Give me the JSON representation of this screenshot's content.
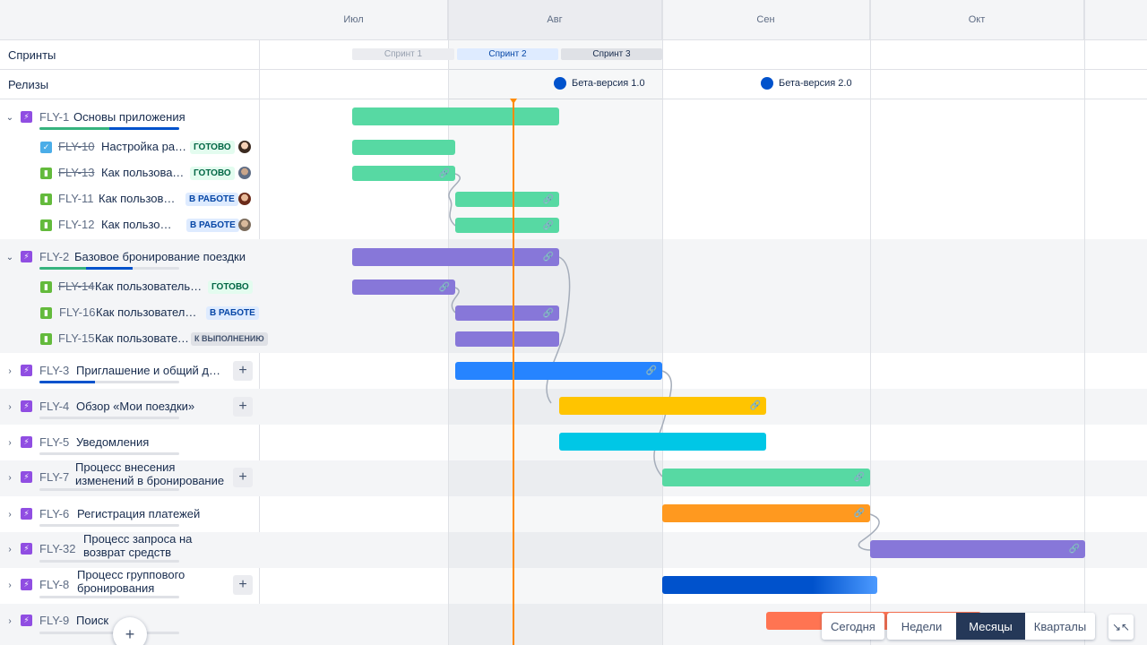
{
  "timeline": {
    "months": [
      "Июл",
      "Авг",
      "Сен",
      "Окт"
    ],
    "sprints_label": "Спринты",
    "releases_label": "Релизы",
    "sprints": [
      "Спринт 1",
      "Спринт 2",
      "Спринт 3"
    ],
    "releases": [
      "Бета-версия 1.0",
      "Бета-версия 2.0"
    ]
  },
  "issues": [
    {
      "key": "FLY-1",
      "title": "Основы приложения",
      "type": "epic",
      "expanded": true
    },
    {
      "key": "FLY-10",
      "title": "Настройка раз…",
      "type": "task",
      "done": true,
      "status": "ГОТОВО"
    },
    {
      "key": "FLY-13",
      "title": "Как пользовате…",
      "type": "story",
      "done": true,
      "status": "ГОТОВО"
    },
    {
      "key": "FLY-11",
      "title": "Как пользов…",
      "type": "story",
      "status": "В РАБОТЕ"
    },
    {
      "key": "FLY-12",
      "title": "Как пользо…",
      "type": "story",
      "status": "В РАБОТЕ"
    },
    {
      "key": "FLY-2",
      "title": "Базовое бронирование поездки",
      "type": "epic",
      "expanded": true
    },
    {
      "key": "FLY-14",
      "title": "Как пользователь,…",
      "type": "story",
      "done": true,
      "status": "ГОТОВО"
    },
    {
      "key": "FLY-16",
      "title": "Как пользовател…",
      "type": "story",
      "status": "В РАБОТЕ"
    },
    {
      "key": "FLY-15",
      "title": "Как пользователь…",
      "type": "story",
      "status": "К ВЫПОЛНЕНИЮ"
    },
    {
      "key": "FLY-3",
      "title": "Приглашение и общий доступ",
      "type": "epic"
    },
    {
      "key": "FLY-4",
      "title": "Обзор «Мои поездки»",
      "type": "epic"
    },
    {
      "key": "FLY-5",
      "title": "Уведомления",
      "type": "epic"
    },
    {
      "key": "FLY-7",
      "title": "Процесс внесения изменений в бронирование",
      "type": "epic"
    },
    {
      "key": "FLY-6",
      "title": "Регистрация платежей",
      "type": "epic"
    },
    {
      "key": "FLY-32",
      "title": "Процесс запроса на возврат средств",
      "type": "epic"
    },
    {
      "key": "FLY-8",
      "title": "Процесс группового бронирования",
      "type": "epic"
    },
    {
      "key": "FLY-9",
      "title": "Поиск",
      "type": "epic"
    }
  ],
  "controls": {
    "today": "Сегодня",
    "weeks": "Недели",
    "months": "Месяцы",
    "quarters": "Кварталы",
    "active": "Месяцы"
  },
  "colors": {
    "green": "#57d9a3",
    "purple": "#8777d9",
    "blue": "#2684ff",
    "yellow": "#ffc400",
    "cyan": "#00c7e6",
    "orange": "#ff991f",
    "navy": "#0052cc",
    "red": "#ff7452",
    "today_line": "#ff8b00"
  }
}
